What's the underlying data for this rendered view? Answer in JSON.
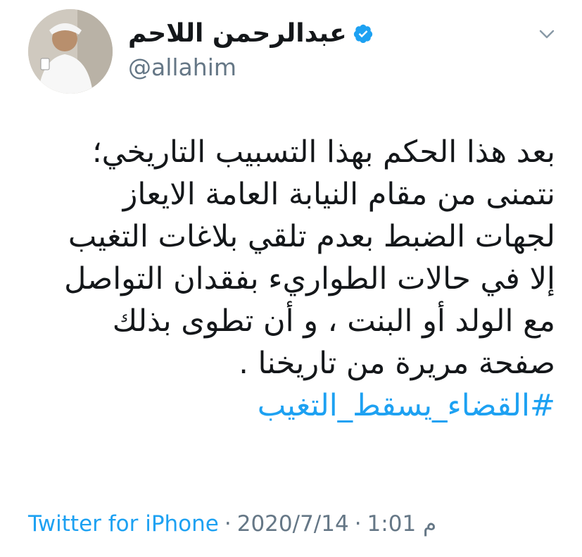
{
  "user": {
    "display_name": "عبدالرحمن اللاحم",
    "handle": "@allahim",
    "verified": true
  },
  "tweet": {
    "lines": [
      "بعد هذا الحكم بهذا التسبيب التاريخي؛",
      "نتمنى من مقام النيابة العامة الايعاز",
      "لجهات الضبط بعدم تلقي بلاغات التغيب",
      "إلا في حالات الطواريء بفقدان التواصل",
      "مع الولد أو البنت ، و أن تطوى بذلك",
      "صفحة مريرة من تاريخنا ."
    ],
    "hashtag": "#القضاء_يسقط_التغيب"
  },
  "meta": {
    "source": "Twitter for iPhone",
    "separator": "·",
    "date": "2020/7/14",
    "time": "1:01 م"
  },
  "icons": {
    "more": "chevron-down-icon",
    "verified": "verified-badge-icon"
  },
  "colors": {
    "accent": "#1da1f2",
    "text": "#14171a",
    "secondary": "#657786"
  }
}
